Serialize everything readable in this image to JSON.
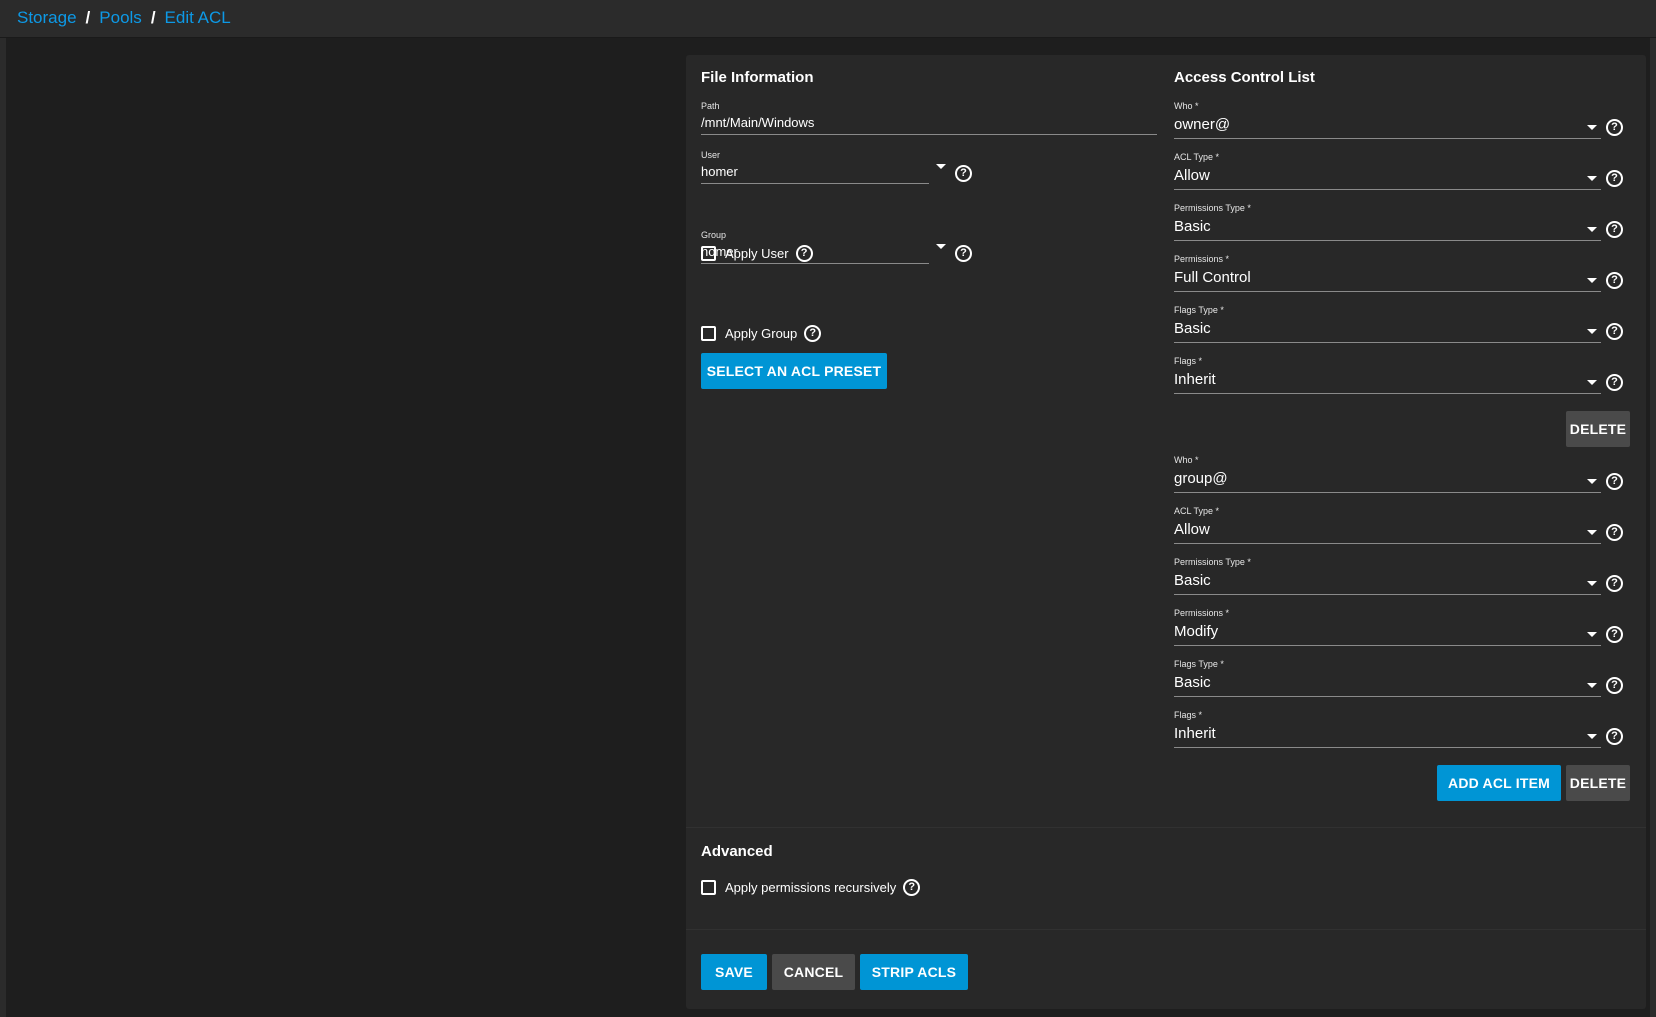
{
  "breadcrumb": {
    "items": [
      "Storage",
      "Pools",
      "Edit ACL"
    ],
    "separator": "/"
  },
  "file_info": {
    "title": "File Information",
    "path_label": "Path",
    "path_value": "/mnt/Main/Windows",
    "user_label": "User",
    "user_value": "homer",
    "apply_user_label": "Apply User",
    "group_label": "Group",
    "group_value": "homer",
    "apply_group_label": "Apply Group",
    "preset_button": "SELECT AN ACL PRESET"
  },
  "acl": {
    "title": "Access Control List",
    "labels": {
      "who": "Who *",
      "acl_type": "ACL Type *",
      "perm_type": "Permissions Type *",
      "perms": "Permissions *",
      "flags_type": "Flags Type *",
      "flags": "Flags *"
    },
    "entries": [
      {
        "who": "owner@",
        "acl_type": "Allow",
        "perm_type": "Basic",
        "perms": "Full Control",
        "flags_type": "Basic",
        "flags": "Inherit"
      },
      {
        "who": "group@",
        "acl_type": "Allow",
        "perm_type": "Basic",
        "perms": "Modify",
        "flags_type": "Basic",
        "flags": "Inherit"
      }
    ],
    "delete_button": "DELETE",
    "add_button": "ADD ACL ITEM"
  },
  "advanced": {
    "title": "Advanced",
    "recursive_label": "Apply permissions recursively"
  },
  "actions": {
    "save": "SAVE",
    "cancel": "CANCEL",
    "strip": "STRIP ACLS"
  },
  "colors": {
    "accent": "#0095d5",
    "link": "#0d99e6",
    "card": "#282828",
    "background": "#1e1e1e"
  }
}
